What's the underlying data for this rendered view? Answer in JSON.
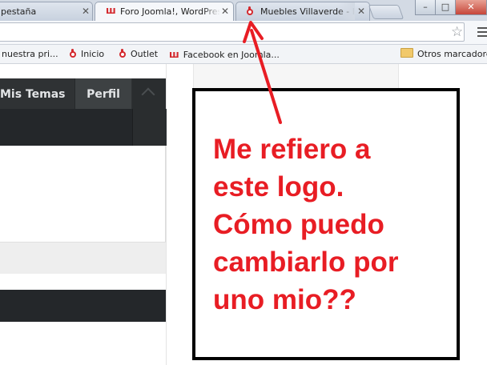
{
  "tabs": [
    {
      "title": "pestaña",
      "active": false,
      "icon": "none"
    },
    {
      "title": "Foro Joomla!, WordPress",
      "active": true,
      "icon": "joomla-w-logo-icon"
    },
    {
      "title": "Muebles Villaverde - Inicio",
      "active": false,
      "icon": "red-pin-logo-icon"
    }
  ],
  "window_controls": {
    "minimize": "–",
    "maximize": "□",
    "close": "✕"
  },
  "omnibox": {
    "url": "",
    "star_icon": "star-icon",
    "menu_icon": "wrench-menu-icon"
  },
  "bookmarks": [
    {
      "label": "nuestra pri...",
      "icon": "none"
    },
    {
      "label": "Inicio",
      "icon": "red-pin-logo-icon"
    },
    {
      "label": "Outlet",
      "icon": "red-pin-logo-icon"
    },
    {
      "label": "Facebook en Joomla...",
      "icon": "joomla-w-logo-icon"
    },
    {
      "label": "Otros marcadores",
      "icon": "folder-icon"
    }
  ],
  "site_nav": {
    "item1": "Mis Temas",
    "item2": "Perfil",
    "dropdown_icon": "chevron-up-icon"
  },
  "annotation": {
    "text": "Me refiero a\neste logo.\nCómo puedo\ncambiarlo por\nuno mio??",
    "color": "#e81d24",
    "arrow_color": "#e81d24"
  },
  "colors": {
    "tab_strip": "#d3dae4",
    "nav_dark": "#2f3234",
    "brand_red": "#d4282d"
  }
}
